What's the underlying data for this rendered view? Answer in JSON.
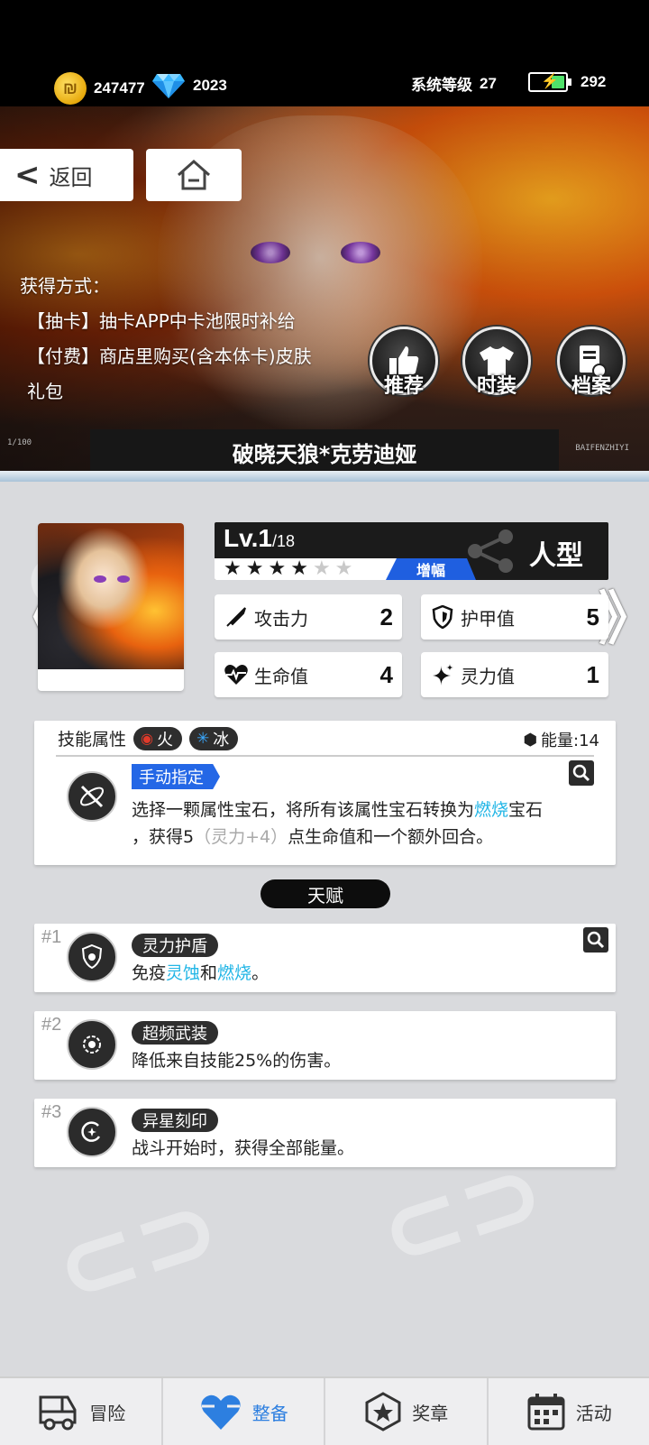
{
  "status": {
    "coins": "247477",
    "gems": "2023",
    "system_level_label": "系统等级",
    "system_level": "27",
    "stamina": "292"
  },
  "hero": {
    "back_label": "返回",
    "acquire_title": "获得方式：",
    "acquire_lines": [
      "【抽卡】抽卡APP中卡池限时补给",
      "【付费】商店里购买(含本体卡)皮肤",
      "礼包"
    ],
    "buttons": {
      "recommend": "推荐",
      "outfit": "时装",
      "archive": "档案"
    },
    "character_name": "破晓天狼*克劳迪娅",
    "band_left_code": "1/100",
    "band_right_code": "BAIFENZHIYI"
  },
  "character": {
    "level": "Lv.1",
    "level_max": "/18",
    "stars_on": 4,
    "stars_total": 6,
    "boost_label": "增幅",
    "type": "人型",
    "stats": {
      "attack_label": "攻击力",
      "attack": "2",
      "armor_label": "护甲值",
      "armor": "5",
      "hp_label": "生命值",
      "hp": "4",
      "spirit_label": "灵力值",
      "spirit": "1"
    }
  },
  "skill": {
    "attribute_label": "技能属性",
    "elements": [
      {
        "name": "火",
        "color": "#e03a2a"
      },
      {
        "name": "冰",
        "color": "#3aa8ff"
      }
    ],
    "energy_label": "能量:14",
    "tag": "手动指定",
    "desc_part1": "选择一颗属性宝石，将所有该属性宝石转换为",
    "desc_highlight": "燃烧",
    "desc_part2": "宝石",
    "desc_part3": "，获得5",
    "desc_dim": "（灵力+4）",
    "desc_part4": "点生命值和一个额外回合。"
  },
  "talents": {
    "title": "天赋",
    "items": [
      {
        "num": "#1",
        "name": "灵力护盾",
        "desc_a": "免疫",
        "desc_hl1": "灵蚀",
        "desc_b": "和",
        "desc_hl2": "燃烧",
        "desc_c": "。"
      },
      {
        "num": "#2",
        "name": "超频武装",
        "desc": "降低来自技能25%的伤害。"
      },
      {
        "num": "#3",
        "name": "异星刻印",
        "desc": "战斗开始时，获得全部能量。"
      }
    ]
  },
  "nav": {
    "adventure": "冒险",
    "equip": "整备",
    "medal": "奖章",
    "events": "活动"
  },
  "colors": {
    "accent_blue": "#2467e6",
    "highlight_cyan": "#23b6e6",
    "active_nav": "#2d7fe0"
  }
}
